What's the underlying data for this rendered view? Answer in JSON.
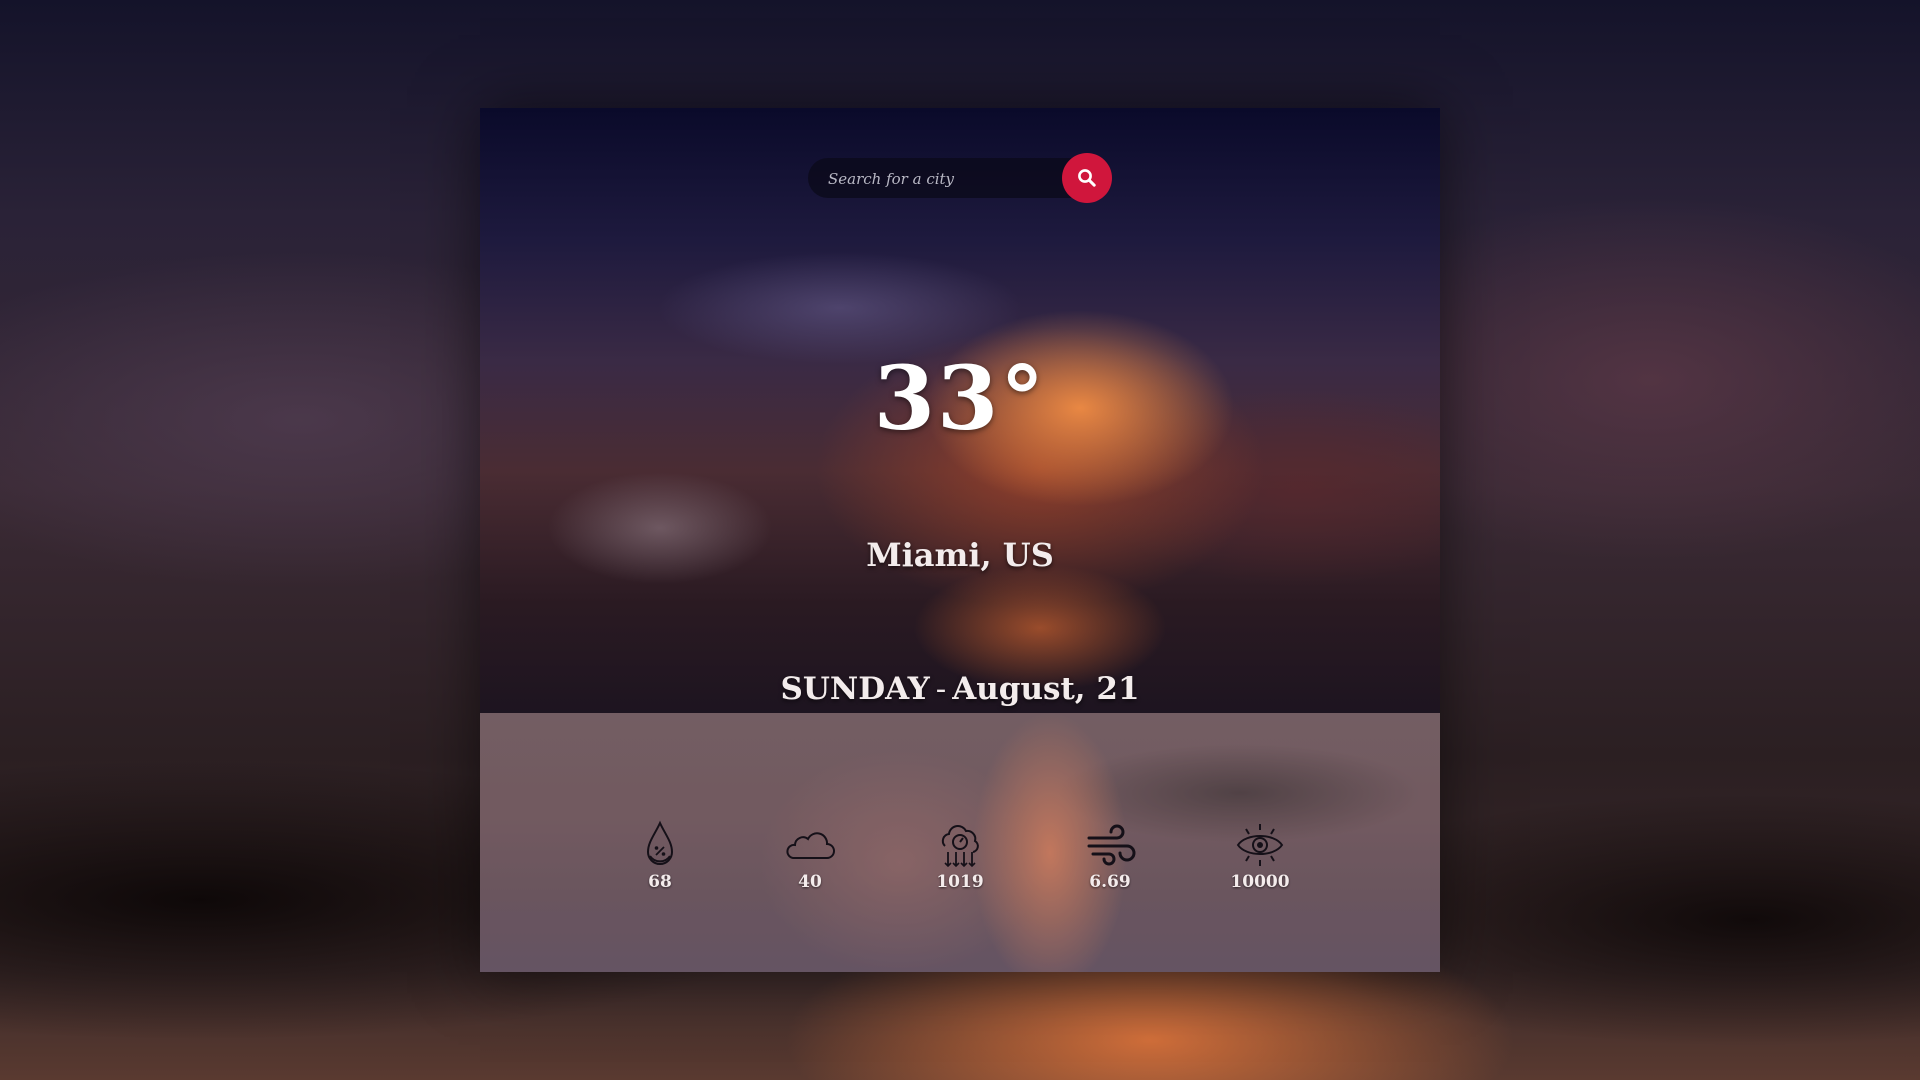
{
  "search": {
    "placeholder": "Search for a city"
  },
  "weather": {
    "temperature": "33°",
    "location": "Miami, US",
    "day": "SUNDAY",
    "separator": "-",
    "date": "August, 21"
  },
  "stats": [
    {
      "icon": "humidity-icon",
      "value": "68"
    },
    {
      "icon": "cloud-icon",
      "value": "40"
    },
    {
      "icon": "pressure-icon",
      "value": "1019"
    },
    {
      "icon": "wind-icon",
      "value": "6.69"
    },
    {
      "icon": "visibility-icon",
      "value": "10000"
    }
  ],
  "colors": {
    "accent": "#d0163c",
    "text": "#ffffff"
  }
}
